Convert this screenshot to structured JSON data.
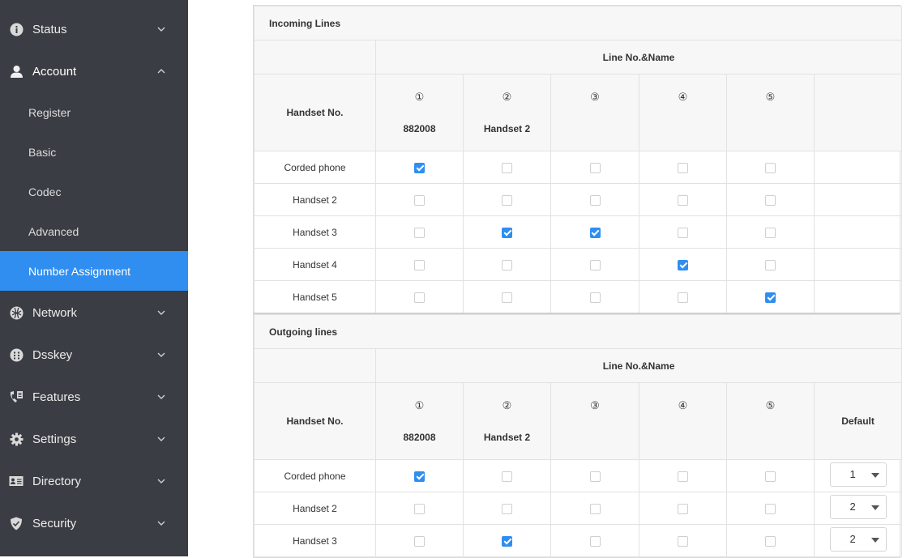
{
  "sidebar": {
    "items": [
      {
        "label": "Status",
        "icon": "info-icon",
        "expanded": false
      },
      {
        "label": "Account",
        "icon": "user-icon",
        "expanded": true
      },
      {
        "label": "Network",
        "icon": "network-icon",
        "expanded": false
      },
      {
        "label": "Dsskey",
        "icon": "dsskey-icon",
        "expanded": false
      },
      {
        "label": "Features",
        "icon": "features-icon",
        "expanded": false
      },
      {
        "label": "Settings",
        "icon": "gear-icon",
        "expanded": false
      },
      {
        "label": "Directory",
        "icon": "directory-icon",
        "expanded": false
      },
      {
        "label": "Security",
        "icon": "shield-icon",
        "expanded": false
      }
    ],
    "account_sub": [
      "Register",
      "Basic",
      "Codec",
      "Advanced",
      "Number Assignment"
    ],
    "active_sub": "Number Assignment"
  },
  "incoming": {
    "title": "Incoming Lines",
    "line_header": "Line No.&Name",
    "handset_header": "Handset No.",
    "lines": [
      {
        "num": "①",
        "name": "882008"
      },
      {
        "num": "②",
        "name": "Handset 2"
      },
      {
        "num": "③",
        "name": ""
      },
      {
        "num": "④",
        "name": ""
      },
      {
        "num": "⑤",
        "name": ""
      }
    ],
    "rows": [
      {
        "label": "Corded phone",
        "checks": [
          true,
          false,
          false,
          false,
          false
        ]
      },
      {
        "label": "Handset 2",
        "checks": [
          false,
          false,
          false,
          false,
          false
        ]
      },
      {
        "label": "Handset 3",
        "checks": [
          false,
          true,
          true,
          false,
          false
        ]
      },
      {
        "label": "Handset 4",
        "checks": [
          false,
          false,
          false,
          true,
          false
        ]
      },
      {
        "label": "Handset 5",
        "checks": [
          false,
          false,
          false,
          false,
          true
        ]
      }
    ]
  },
  "outgoing": {
    "title": "Outgoing lines",
    "line_header": "Line No.&Name",
    "handset_header": "Handset No.",
    "default_header": "Default",
    "lines": [
      {
        "num": "①",
        "name": "882008"
      },
      {
        "num": "②",
        "name": "Handset 2"
      },
      {
        "num": "③",
        "name": ""
      },
      {
        "num": "④",
        "name": ""
      },
      {
        "num": "⑤",
        "name": ""
      }
    ],
    "rows": [
      {
        "label": "Corded phone",
        "checks": [
          true,
          false,
          false,
          false,
          false
        ],
        "default": "1"
      },
      {
        "label": "Handset 2",
        "checks": [
          false,
          false,
          false,
          false,
          false
        ],
        "default": "2"
      },
      {
        "label": "Handset 3",
        "checks": [
          false,
          true,
          false,
          false,
          false
        ],
        "default": "2"
      }
    ]
  },
  "colors": {
    "sidebar_bg": "#3a3d43",
    "accent": "#2f8ef0"
  }
}
